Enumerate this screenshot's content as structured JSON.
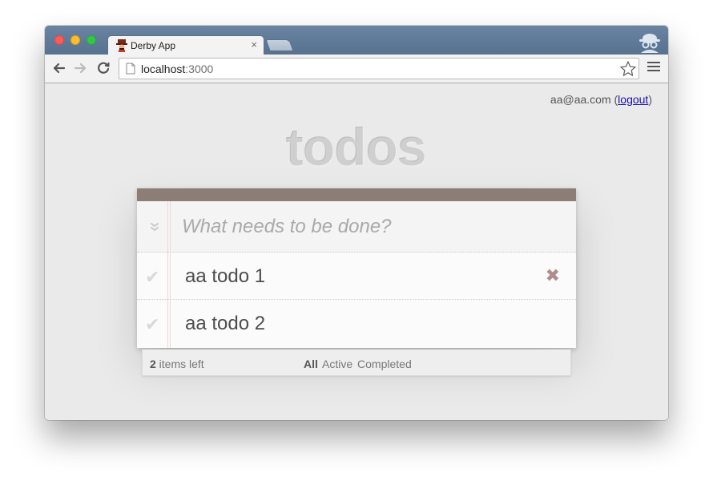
{
  "browser": {
    "tab_title": "Derby App",
    "tab_close_glyph": "×",
    "url_host": "localhost",
    "url_port": ":3000",
    "icons": [
      "favicon-icon",
      "incognito-icon",
      "back-arrow-icon",
      "forward-arrow-icon",
      "reload-icon",
      "page-icon",
      "bookmark-star-icon",
      "menu-icon"
    ]
  },
  "user": {
    "email": "aa@aa.com",
    "open_paren": " (",
    "logout_label": "logout",
    "close_paren": ")"
  },
  "app": {
    "title": "todos",
    "new_todo_placeholder": "What needs to be done?",
    "toggle_all_glyph": "»",
    "check_glyph": "✔",
    "destroy_glyph": "✖",
    "todos": [
      {
        "title": "aa todo 1",
        "completed": false
      },
      {
        "title": "aa todo 2",
        "completed": false
      }
    ],
    "footer": {
      "count": "2",
      "count_label": " items left",
      "filters": [
        "All",
        "Active",
        "Completed"
      ],
      "selected_filter": "All"
    }
  },
  "colors": {
    "card_header": "#8d7d77",
    "destroy": "#af8d8d",
    "titlebar": "#56728f"
  }
}
